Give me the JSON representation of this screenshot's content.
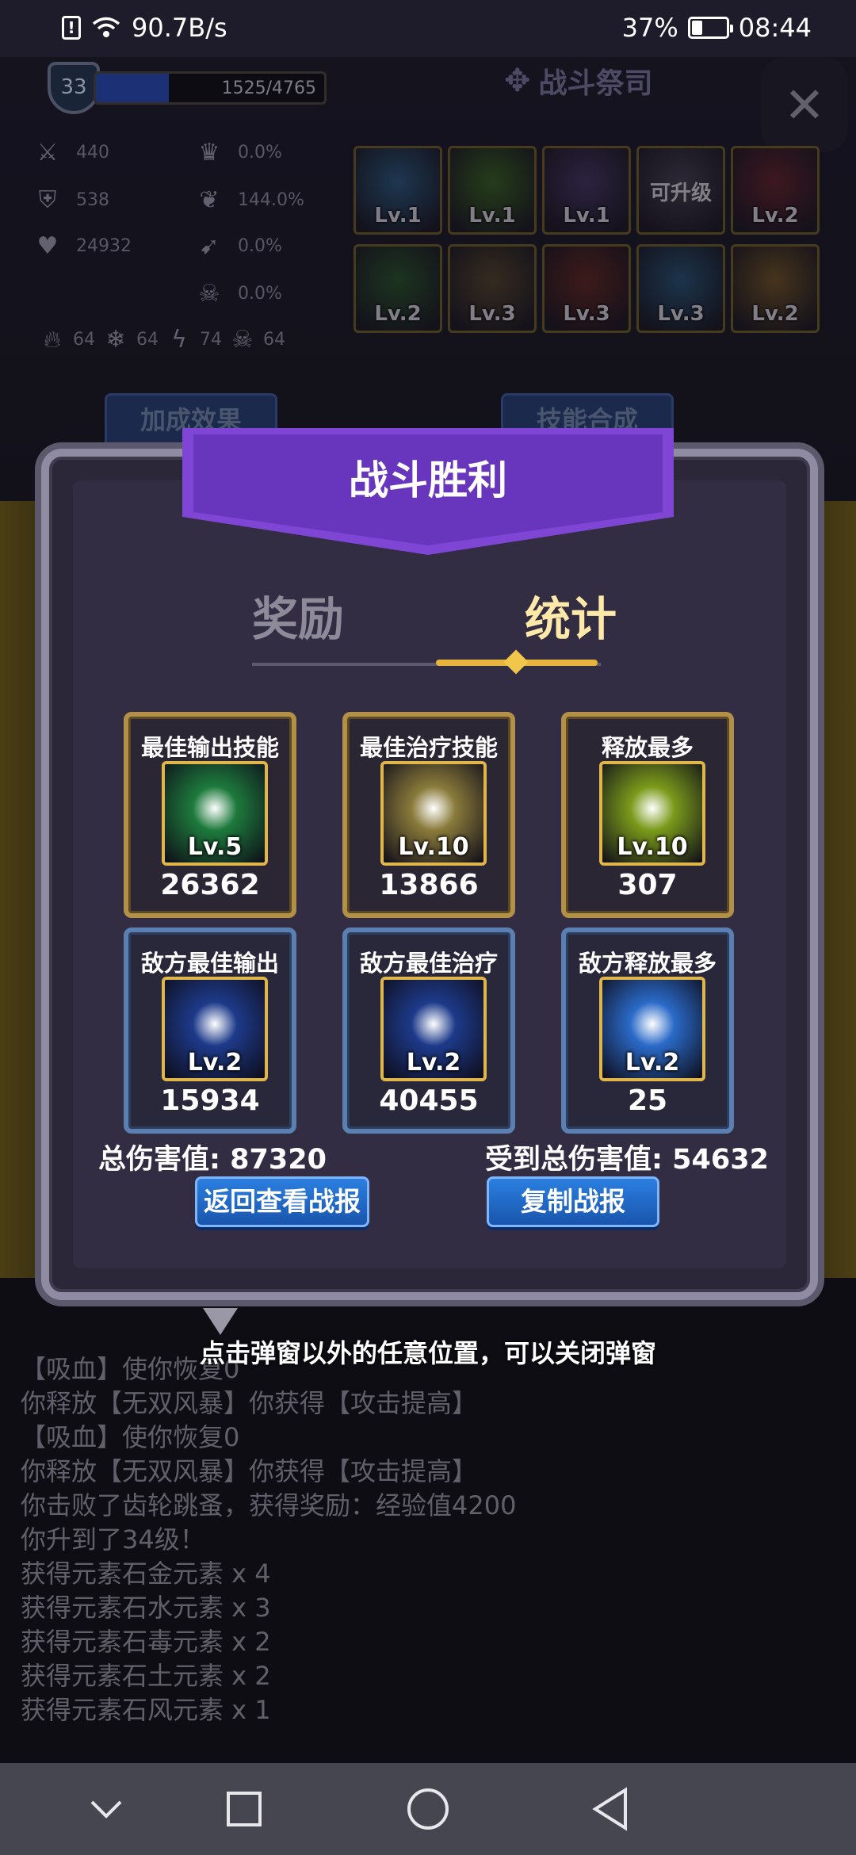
{
  "status_bar": {
    "network_speed": "90.7B/s",
    "battery_text": "37%",
    "battery_level": 0.37,
    "time": "08:44"
  },
  "header": {
    "player_level": "33",
    "xp_text": "1525/4765",
    "xp_progress": 0.32,
    "title": "战斗祭司",
    "close_icon": "close-icon"
  },
  "attributes": [
    {
      "icon": "sword-icon",
      "value": "440"
    },
    {
      "icon": "shield-icon",
      "value": "538"
    },
    {
      "icon": "heart-icon",
      "value": "24932"
    }
  ],
  "rates": [
    {
      "icon": "crown-icon",
      "value": "0.0%"
    },
    {
      "icon": "heart-wing-icon",
      "value": "144.0%"
    },
    {
      "icon": "dodge-icon",
      "value": "0.0%"
    },
    {
      "icon": "skull-icon",
      "value": "0.0%"
    }
  ],
  "elements": [
    {
      "icon": "fire-icon",
      "value": "64"
    },
    {
      "icon": "snowflake-icon",
      "value": "64"
    },
    {
      "icon": "lightning-icon",
      "value": "74"
    },
    {
      "icon": "poison-icon",
      "value": "64"
    }
  ],
  "skills": [
    {
      "label": "Lv.1",
      "color": "#2f5f8a"
    },
    {
      "label": "Lv.1",
      "color": "#3d6a25"
    },
    {
      "label": "Lv.1",
      "color": "#4a3a6a"
    },
    {
      "label": "可升级",
      "color": "#4a4458"
    },
    {
      "label": "Lv.2",
      "color": "#6a2530"
    },
    {
      "label": "Lv.2",
      "color": "#2d5a30"
    },
    {
      "label": "Lv.3",
      "color": "#5a4a30"
    },
    {
      "label": "Lv.3",
      "color": "#6a2a25"
    },
    {
      "label": "Lv.3",
      "color": "#2c5a80"
    },
    {
      "label": "Lv.2",
      "color": "#7a5a2a"
    }
  ],
  "bg_buttons": {
    "left": "加成效果",
    "right": "技能合成"
  },
  "dialog": {
    "title": "战斗胜利",
    "tab_reward": "奖励",
    "tab_stats": "统计",
    "cards": [
      {
        "title": "最佳输出技能",
        "level": "Lv.5",
        "value": "26362",
        "style": "gold",
        "icon": "key-skill-icon",
        "color": "#1d7a3c"
      },
      {
        "title": "最佳治疗技能",
        "level": "Lv.10",
        "value": "13866",
        "style": "gold",
        "icon": "healer-skill-icon",
        "color": "#8a7a3a"
      },
      {
        "title": "释放最多",
        "level": "Lv.10",
        "value": "307",
        "style": "gold",
        "icon": "slash-skill-icon",
        "color": "#7a9a1a"
      },
      {
        "title": "敌方最佳输出",
        "level": "Lv.2",
        "value": "15934",
        "style": "blue",
        "icon": "water-drop-icon",
        "color": "#1d3a8a"
      },
      {
        "title": "敌方最佳治疗",
        "level": "Lv.2",
        "value": "40455",
        "style": "blue",
        "icon": "water-drop-icon",
        "color": "#1d3a8a"
      },
      {
        "title": "敌方释放最多",
        "level": "Lv.2",
        "value": "25",
        "style": "blue",
        "icon": "water-orb-icon",
        "color": "#2a6ac8"
      }
    ],
    "total_damage": "总伤害值: 87320",
    "total_damage_taken": "受到总伤害值: 54632",
    "btn_review": "返回查看战报",
    "btn_copy": "复制战报"
  },
  "hint": "点击弹窗以外的任意位置，可以关闭弹窗",
  "log_lines": [
    "【吸血】使你恢复0",
    "你释放【无双风暴】你获得【攻击提高】",
    "【吸血】使你恢复0",
    "你释放【无双风暴】你获得【攻击提高】",
    "你击败了齿轮跳蚤，获得奖励：经验值4200",
    "你升到了34级！",
    "获得元素石金元素 x 4",
    "获得元素石水元素 x 3",
    "获得元素石毒元素 x 2",
    "获得元素石土元素 x 2",
    "获得元素石风元素 x 1"
  ],
  "nav": {
    "down_icon": "chevron-down-icon",
    "recent_icon": "square-icon",
    "home_icon": "circle-icon",
    "back_icon": "triangle-back-icon"
  }
}
